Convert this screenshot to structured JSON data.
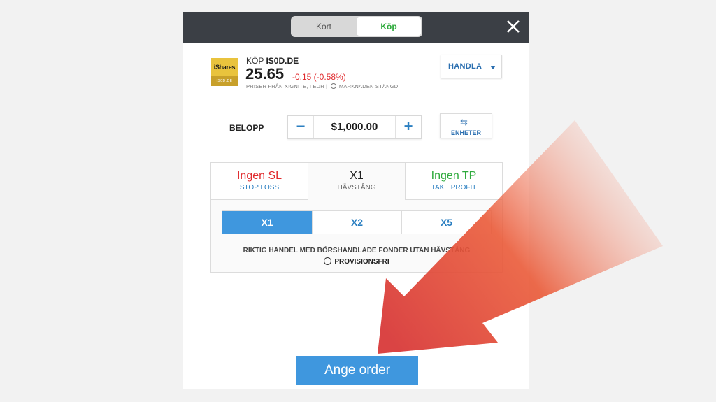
{
  "header": {
    "toggle": {
      "kort": "Kort",
      "kop": "Köp"
    }
  },
  "instrument": {
    "logo_top": "iShares",
    "logo_bottom": "IS0D.DE",
    "action": "KÖP",
    "symbol": "IS0D.DE",
    "price": "25.65",
    "change": "-0.15 (-0.58%)",
    "meta_source": "PRISER FRÅN XIGNITE, I EUR |",
    "meta_status": "MARKNADEN STÄNGD"
  },
  "handla": {
    "label": "HANDLA"
  },
  "amount": {
    "label": "BELOPP",
    "value": "$1,000.00",
    "units_label": "ENHETER"
  },
  "tabs": {
    "stop_loss": {
      "big": "Ingen SL",
      "small": "STOP LOSS"
    },
    "leverage": {
      "big": "X1",
      "small": "HÄVSTÅNG"
    },
    "take_profit": {
      "big": "Ingen TP",
      "small": "TAKE PROFIT"
    }
  },
  "leverage_options": [
    "X1",
    "X2",
    "X5"
  ],
  "note": "RIKTIG HANDEL MED BÖRSHANDLADE FONDER UTAN HÄVSTÅNG",
  "commission": "PROVISIONSFRI",
  "order_button": "Ange order",
  "colors": {
    "accent_blue": "#3f97de",
    "buy_green": "#2eaa3c",
    "loss_red": "#e0292c",
    "topbar": "#3b3f45"
  }
}
